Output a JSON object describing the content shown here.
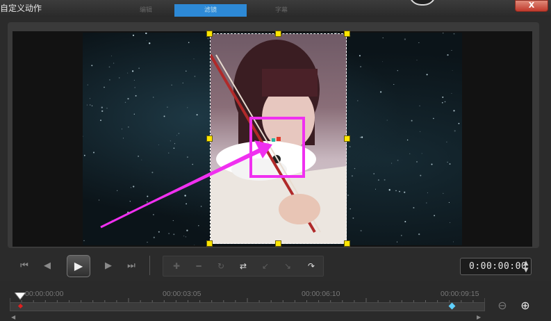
{
  "window": {
    "title": "自定义动作",
    "close_label": "X",
    "tabs": [
      {
        "label": "编辑",
        "active": false
      },
      {
        "label": "滤镜",
        "active": true
      },
      {
        "label": "字幕",
        "active": false
      }
    ]
  },
  "preview": {
    "background": "starfield",
    "subject": "photo of woman playing violin",
    "highlight_color": "#f030f0",
    "handle_color": "#ffe600"
  },
  "controls": {
    "buttons": [
      {
        "name": "go-to-start",
        "icon": "skip-start-icon",
        "glyph": "⏮"
      },
      {
        "name": "previous-frame",
        "icon": "step-back-icon",
        "glyph": "◀"
      },
      {
        "name": "play",
        "icon": "play-icon",
        "glyph": "▶"
      },
      {
        "name": "next-frame",
        "icon": "step-forward-icon",
        "glyph": "▶"
      },
      {
        "name": "go-to-end",
        "icon": "skip-end-icon",
        "glyph": "⏭"
      }
    ],
    "keyframe_tools": [
      {
        "name": "add-keyframe",
        "glyph": "✚",
        "enabled": false
      },
      {
        "name": "remove-keyframe",
        "glyph": "━",
        "enabled": false
      },
      {
        "name": "reverse-keyframe",
        "glyph": "↻",
        "enabled": false
      },
      {
        "name": "swap-keyframes",
        "glyph": "⇄",
        "enabled": true
      },
      {
        "name": "move-keyframe-left",
        "glyph": "↙",
        "enabled": false
      },
      {
        "name": "move-keyframe-right",
        "glyph": "↘",
        "enabled": false
      },
      {
        "name": "goto-keyframe",
        "glyph": "↷",
        "enabled": true
      }
    ],
    "timecode": "0:00:00:00"
  },
  "timeline": {
    "tick_labels": [
      "00:00:00:00",
      "00:00:03:05",
      "00:00:06:10",
      "00:00:09:15"
    ],
    "playhead_position": 0,
    "keyframes": [
      {
        "color": "#e02020",
        "time": "00:00:00:00"
      },
      {
        "color": "#5fd0ff",
        "time": "00:00:09:15"
      }
    ]
  }
}
